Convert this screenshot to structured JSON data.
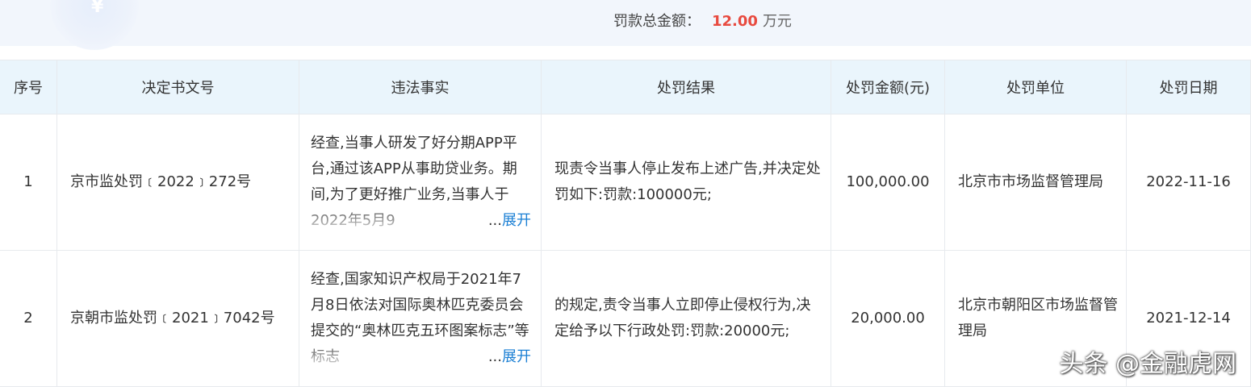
{
  "summary": {
    "label": "罚款总金额：",
    "amount": "12.00",
    "unit": "万元",
    "icon": "yen-coin-icon",
    "icon_glyph": "¥"
  },
  "table": {
    "headers": [
      "序号",
      "决定书文号",
      "违法事实",
      "处罚结果",
      "处罚金额(元)",
      "处罚单位",
      "处罚日期"
    ],
    "expand_text": "...",
    "expand_link": "展开",
    "rows": [
      {
        "no": "1",
        "doc": "京市监处罚﹝2022﹞272号",
        "fact": "经查,当事人研发了好分期APP平台,通过该APP从事助贷业务。期间,为了更好推广业务,当事人于2022年5月9",
        "result": "现责令当事人停止发布上述广告,并决定处罚如下:罚款:100000元;",
        "amount": "100,000.00",
        "unit": "北京市市场监督管理局",
        "date": "2022-11-16"
      },
      {
        "no": "2",
        "doc": "京朝市监处罚﹝2021﹞7042号",
        "fact": "经查,国家知识产权局于2021年7月8日依法对国际奥林匹克委员会提交的“奥林匹克五环图案标志”等标志",
        "result": "的规定,责令当事人立即停止侵权行为,决定给予以下行政处罚:罚款:20000元;",
        "amount": "20,000.00",
        "unit": "北京市朝阳区市场监督管理局",
        "date": "2021-12-14"
      }
    ]
  },
  "watermark": "头条 @金融虎网"
}
